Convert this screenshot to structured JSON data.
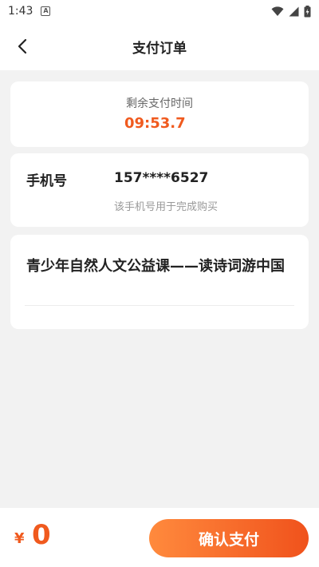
{
  "status_bar": {
    "time": "1:43",
    "notification_icon": "A"
  },
  "header": {
    "title": "支付订单",
    "back_icon": "chevron-left-icon"
  },
  "timer": {
    "label": "剩余支付时间",
    "value": "09:53.7"
  },
  "phone": {
    "label": "手机号",
    "value": "157****6527",
    "note": "该手机号用于完成购买"
  },
  "course": {
    "title": "青少年自然人文公益课——读诗词游中国"
  },
  "footer": {
    "currency": "¥",
    "price": "0",
    "confirm_label": "确认支付"
  },
  "colors": {
    "accent": "#f05a1e",
    "button_start": "#ff8a3d",
    "button_end": "#f0521c"
  }
}
